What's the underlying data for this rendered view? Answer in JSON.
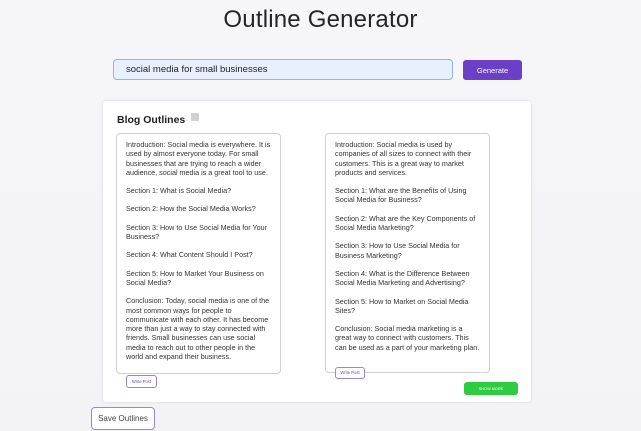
{
  "header": {
    "title": "Outline Generator"
  },
  "search": {
    "value": "social media for small businesses",
    "generate_label": "Generate"
  },
  "panel": {
    "title": "Blog Outlines",
    "icon": "info-icon"
  },
  "outlines": [
    {
      "paragraphs": [
        "Introduction: Social media is everywhere. It is used by almost everyone today. For small businesses that are trying to reach a wider audience, social media is a great tool to use.",
        "Section 1: What is Social Media?",
        "Section 2: How the Social Media Works?",
        "Section 3: How to Use Social Media for Your Business?",
        "Section 4: What Content Should I Post?",
        "Section 5: How to Market Your Business on Social Media?",
        "Conclusion: Today, social media is one of the most common ways for people to communicate with each other. It has become more than just a way to stay connected with friends. Small businesses can use social media to reach out to other people in the world and expand their business."
      ],
      "write_label": "Write Post"
    },
    {
      "paragraphs": [
        "Introduction: Social media is used by companies of all sizes to connect with their customers. This is a great way to market products and services.",
        "Section 1: What are the Benefits of Using Social Media for Business?",
        "Section 2: What are the Key Components of Social Media Marketing?",
        "Section 3: How to Use Social Media for Business Marketing?",
        "Section 4: What is the Difference Between Social Media Marketing and Advertising?",
        "Section 5: How to Market on Social Media Sites?",
        "Conclusion: Social media marketing is a great way to connect with customers. This can be used as a part of your marketing plan."
      ],
      "write_label": "Write Post"
    }
  ],
  "actions": {
    "green_label": "SHOW MORE",
    "save_label": "Save Outlines"
  },
  "colors": {
    "accent": "#6b3fc6",
    "success": "#2ecc40",
    "input_bg": "#e8f0fe"
  }
}
